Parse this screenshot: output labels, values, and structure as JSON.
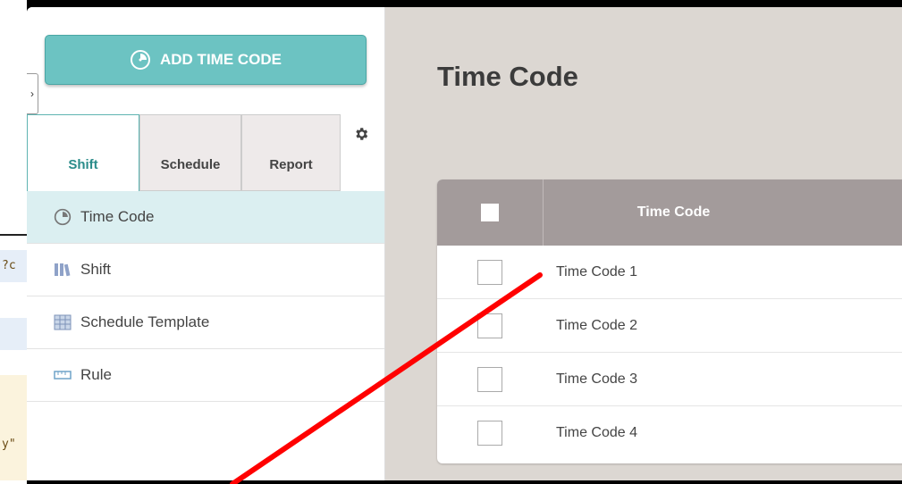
{
  "bg_fragment": {
    "texts": [
      "?c",
      "y\""
    ]
  },
  "sidebar": {
    "add_button_label": "ADD TIME CODE",
    "collapse_glyph": "›",
    "tabs": [
      {
        "label": "Shift",
        "active": true
      },
      {
        "label": "Schedule",
        "active": false
      },
      {
        "label": "Report",
        "active": false
      }
    ],
    "menu": [
      {
        "label": "Time Code",
        "icon": "clock-icon",
        "active": true
      },
      {
        "label": "Shift",
        "icon": "shift-icon",
        "active": false
      },
      {
        "label": "Schedule Template",
        "icon": "calendar-grid-icon",
        "active": false
      },
      {
        "label": "Rule",
        "icon": "ruler-icon",
        "active": false
      }
    ]
  },
  "main": {
    "title": "Time Code",
    "table": {
      "header": "Time Code",
      "rows": [
        "Time Code 1",
        "Time Code 2",
        "Time Code 3",
        "Time Code 4"
      ]
    }
  },
  "colors": {
    "accent": "#6cc3c2",
    "active_tab_text": "#2a8c8a",
    "menu_active_bg": "#dbeff1",
    "table_header": "#a39b9b",
    "main_bg": "#dcd7d2",
    "annotation_line": "#ff0000"
  }
}
